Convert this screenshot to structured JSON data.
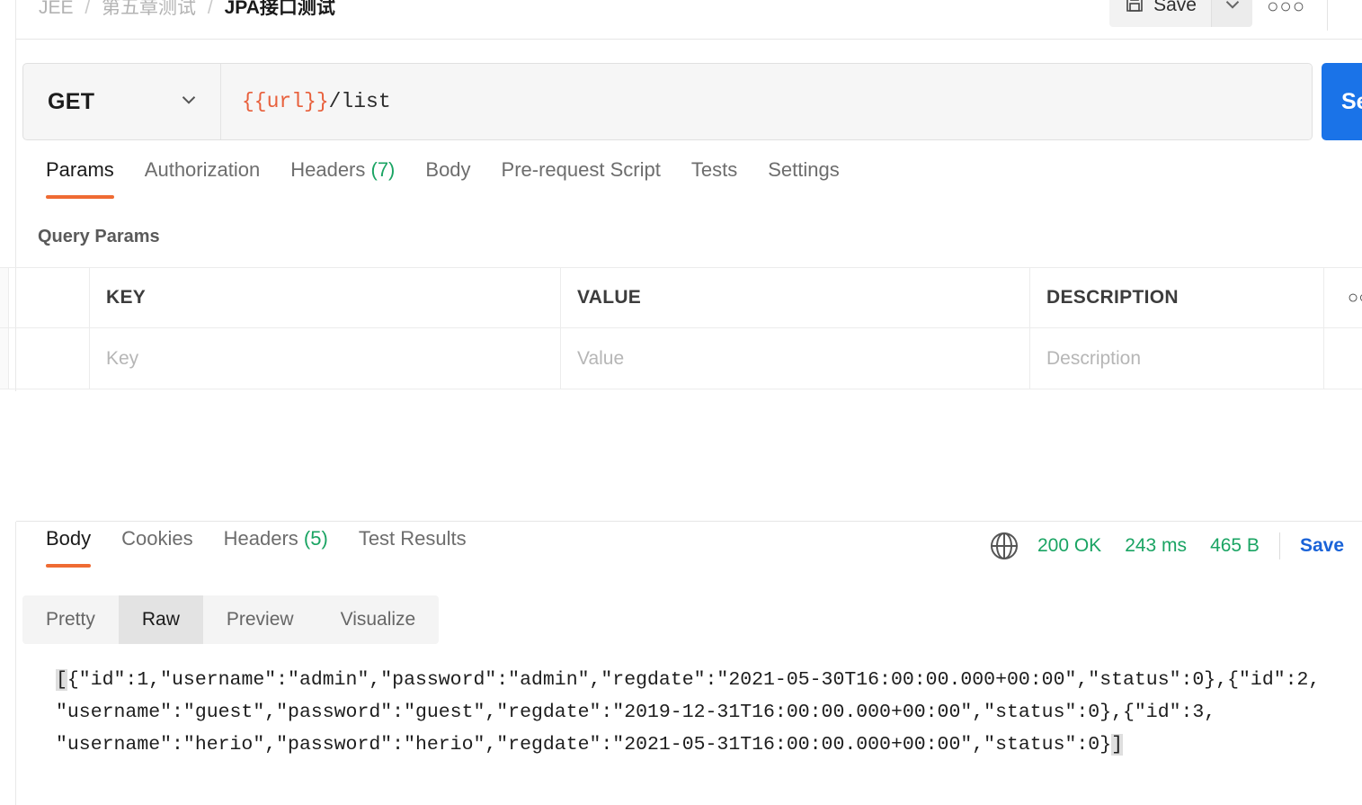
{
  "header": {
    "breadcrumb": [
      "JEE",
      "第五章测试",
      "JPA接口测试"
    ],
    "sep": "/",
    "save_label": "Save",
    "save_icon": "floppy-disk-icon",
    "caret_icon": "chevron-down-icon",
    "more_label": "○○○"
  },
  "request": {
    "method": "GET",
    "method_caret": "chevron-down-icon",
    "url_variable": "{{url}}",
    "url_path": "/list",
    "send_label": "Send",
    "tabs": [
      {
        "label": "Params",
        "count": "",
        "active": true
      },
      {
        "label": "Authorization",
        "count": "",
        "active": false
      },
      {
        "label": "Headers",
        "count": "(7)",
        "active": false
      },
      {
        "label": "Body",
        "count": "",
        "active": false
      },
      {
        "label": "Pre-request Script",
        "count": "",
        "active": false
      },
      {
        "label": "Tests",
        "count": "",
        "active": false
      },
      {
        "label": "Settings",
        "count": "",
        "active": false
      }
    ]
  },
  "query_params": {
    "title": "Query Params",
    "columns": [
      "KEY",
      "VALUE",
      "DESCRIPTION"
    ],
    "bulk_edit_icon": "○○",
    "placeholders": {
      "key": "Key",
      "value": "Value",
      "description": "Description"
    }
  },
  "response": {
    "tabs": [
      {
        "label": "Body",
        "count": "",
        "active": true
      },
      {
        "label": "Cookies",
        "count": "",
        "active": false
      },
      {
        "label": "Headers",
        "count": "(5)",
        "active": false
      },
      {
        "label": "Test Results",
        "count": "",
        "active": false
      }
    ],
    "globe_icon": "globe-icon",
    "status": "200 OK",
    "time": "243 ms",
    "size": "465 B",
    "save_label": "Save",
    "views": [
      {
        "label": "Pretty",
        "active": false
      },
      {
        "label": "Raw",
        "active": true
      },
      {
        "label": "Preview",
        "active": false
      },
      {
        "label": "Visualize",
        "active": false
      }
    ],
    "body_raw_lines": [
      "[{\"id\":1,\"username\":\"admin\",\"password\":\"admin\",\"regdate\":\"2021-05-30T16:00:00.000+00:00\",\"status\":0},{\"id\":2,",
      "\"username\":\"guest\",\"password\":\"guest\",\"regdate\":\"2019-12-31T16:00:00.000+00:00\",\"status\":0},{\"id\":3,",
      "\"username\":\"herio\",\"password\":\"herio\",\"regdate\":\"2021-05-31T16:00:00.000+00:00\",\"status\":0}]"
    ],
    "body_line1_open_bracket": "[",
    "body_line1_rest": "{\"id\":1,\"username\":\"admin\",\"password\":\"admin\",\"regdate\":\"2021-05-30T16:00:00.000+00:00\",\"status\":0},{\"id\":2,",
    "body_line2": "\"username\":\"guest\",\"password\":\"guest\",\"regdate\":\"2019-12-31T16:00:00.000+00:00\",\"status\":0},{\"id\":3,",
    "body_line3_main": "\"username\":\"herio\",\"password\":\"herio\",\"regdate\":\"2021-05-31T16:00:00.000+00:00\",\"status\":0}",
    "body_line3_close_bracket": "]"
  },
  "colors": {
    "accent_orange": "#ef6b33",
    "send_blue": "#1a73e8",
    "status_green": "#1aa463",
    "save_link_blue": "#1a63d8",
    "variable_unresolved": "#e8603c"
  }
}
